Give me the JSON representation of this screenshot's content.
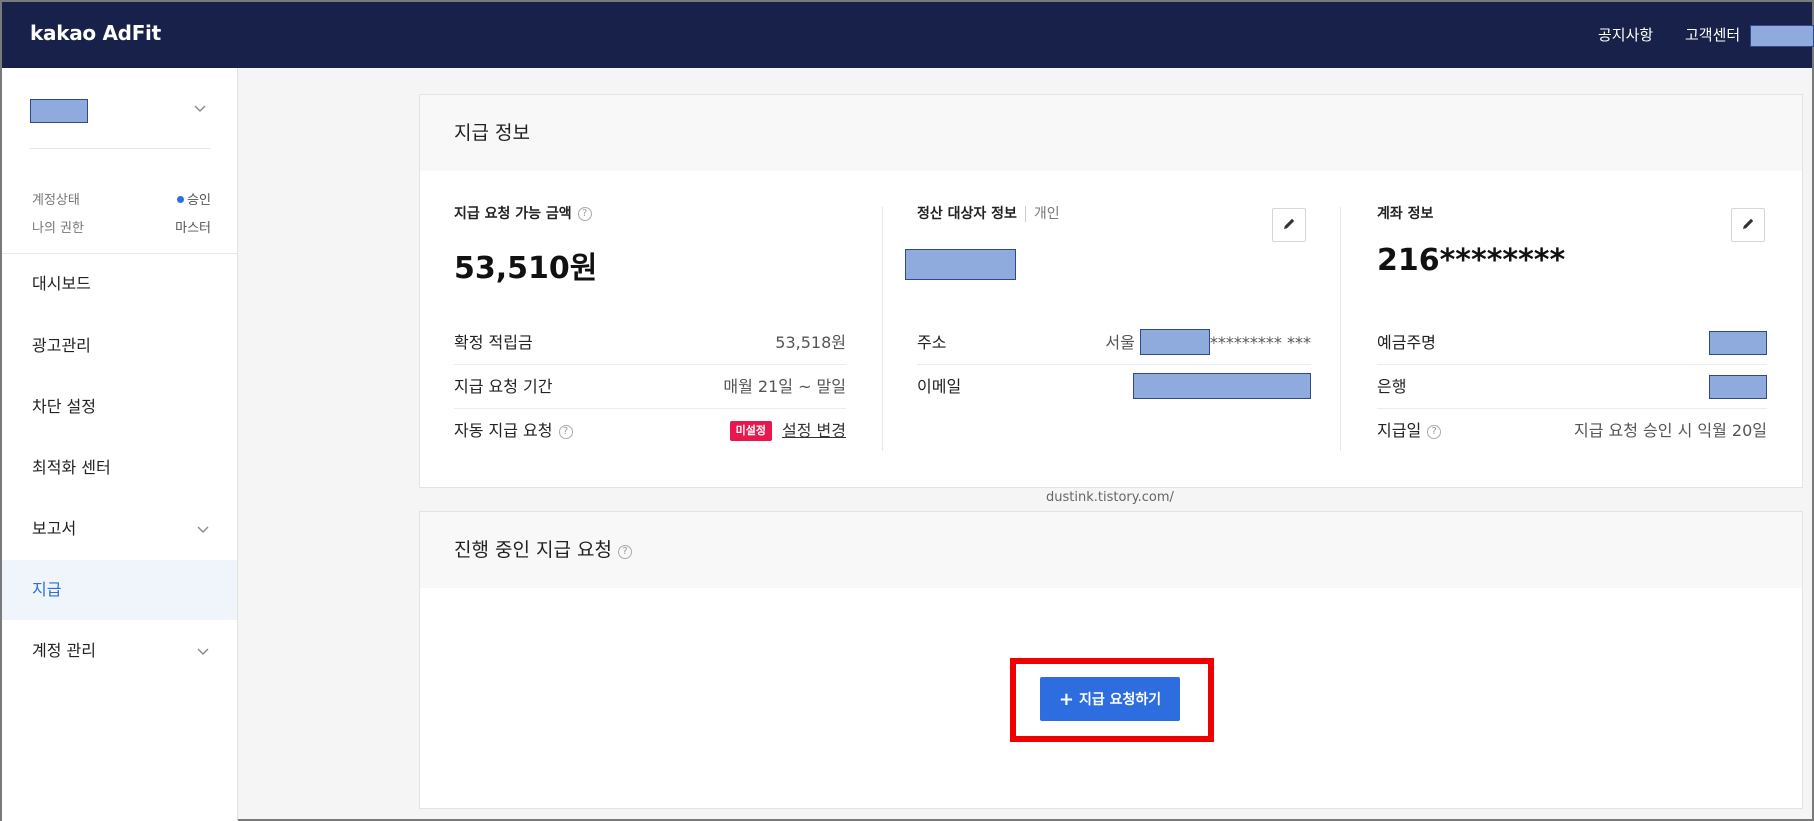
{
  "topbar": {
    "logo": "kakao AdFit",
    "notice": "공지사항",
    "support": "고객센터"
  },
  "sidebar": {
    "account_status_label": "계정상태",
    "account_status_value": "승인",
    "role_label": "나의 권한",
    "role_value": "마스터",
    "items": [
      {
        "label": "대시보드"
      },
      {
        "label": "광고관리"
      },
      {
        "label": "차단 설정"
      },
      {
        "label": "최적화 센터"
      },
      {
        "label": "보고서"
      },
      {
        "label": "지급"
      },
      {
        "label": "계정 관리"
      }
    ]
  },
  "payment_info": {
    "title": "지급 정보",
    "available": {
      "label": "지급 요청 가능 금액",
      "amount": "53,510원",
      "rows": [
        {
          "key": "확정 적립금",
          "value": "53,518원"
        },
        {
          "key": "지급 요청 기간",
          "value": "매월 21일 ~ 말일"
        },
        {
          "key": "자동 지급 요청",
          "badge": "미설정",
          "link": "설정 변경"
        }
      ]
    },
    "payee": {
      "label": "정산 대상자 정보",
      "type": "개인",
      "address_label": "주소",
      "address_prefix": "서울",
      "address_suffix": "********* ***",
      "email_label": "이메일"
    },
    "account": {
      "label": "계좌 정보",
      "number": "216********",
      "holder_label": "예금주명",
      "bank_label": "은행",
      "payday_label": "지급일",
      "payday_value": "지급 요청 승인 시 익월 20일"
    }
  },
  "watermark": "dustink.tistory.com/",
  "pending": {
    "title": "진행 중인 지급 요청",
    "button_label": "지급 요청하기"
  },
  "colors": {
    "topbar": "#18214a",
    "accent": "#2d6de0",
    "badge": "#e8174e",
    "highlight_frame": "#f00000",
    "redaction": "#8faadc"
  }
}
